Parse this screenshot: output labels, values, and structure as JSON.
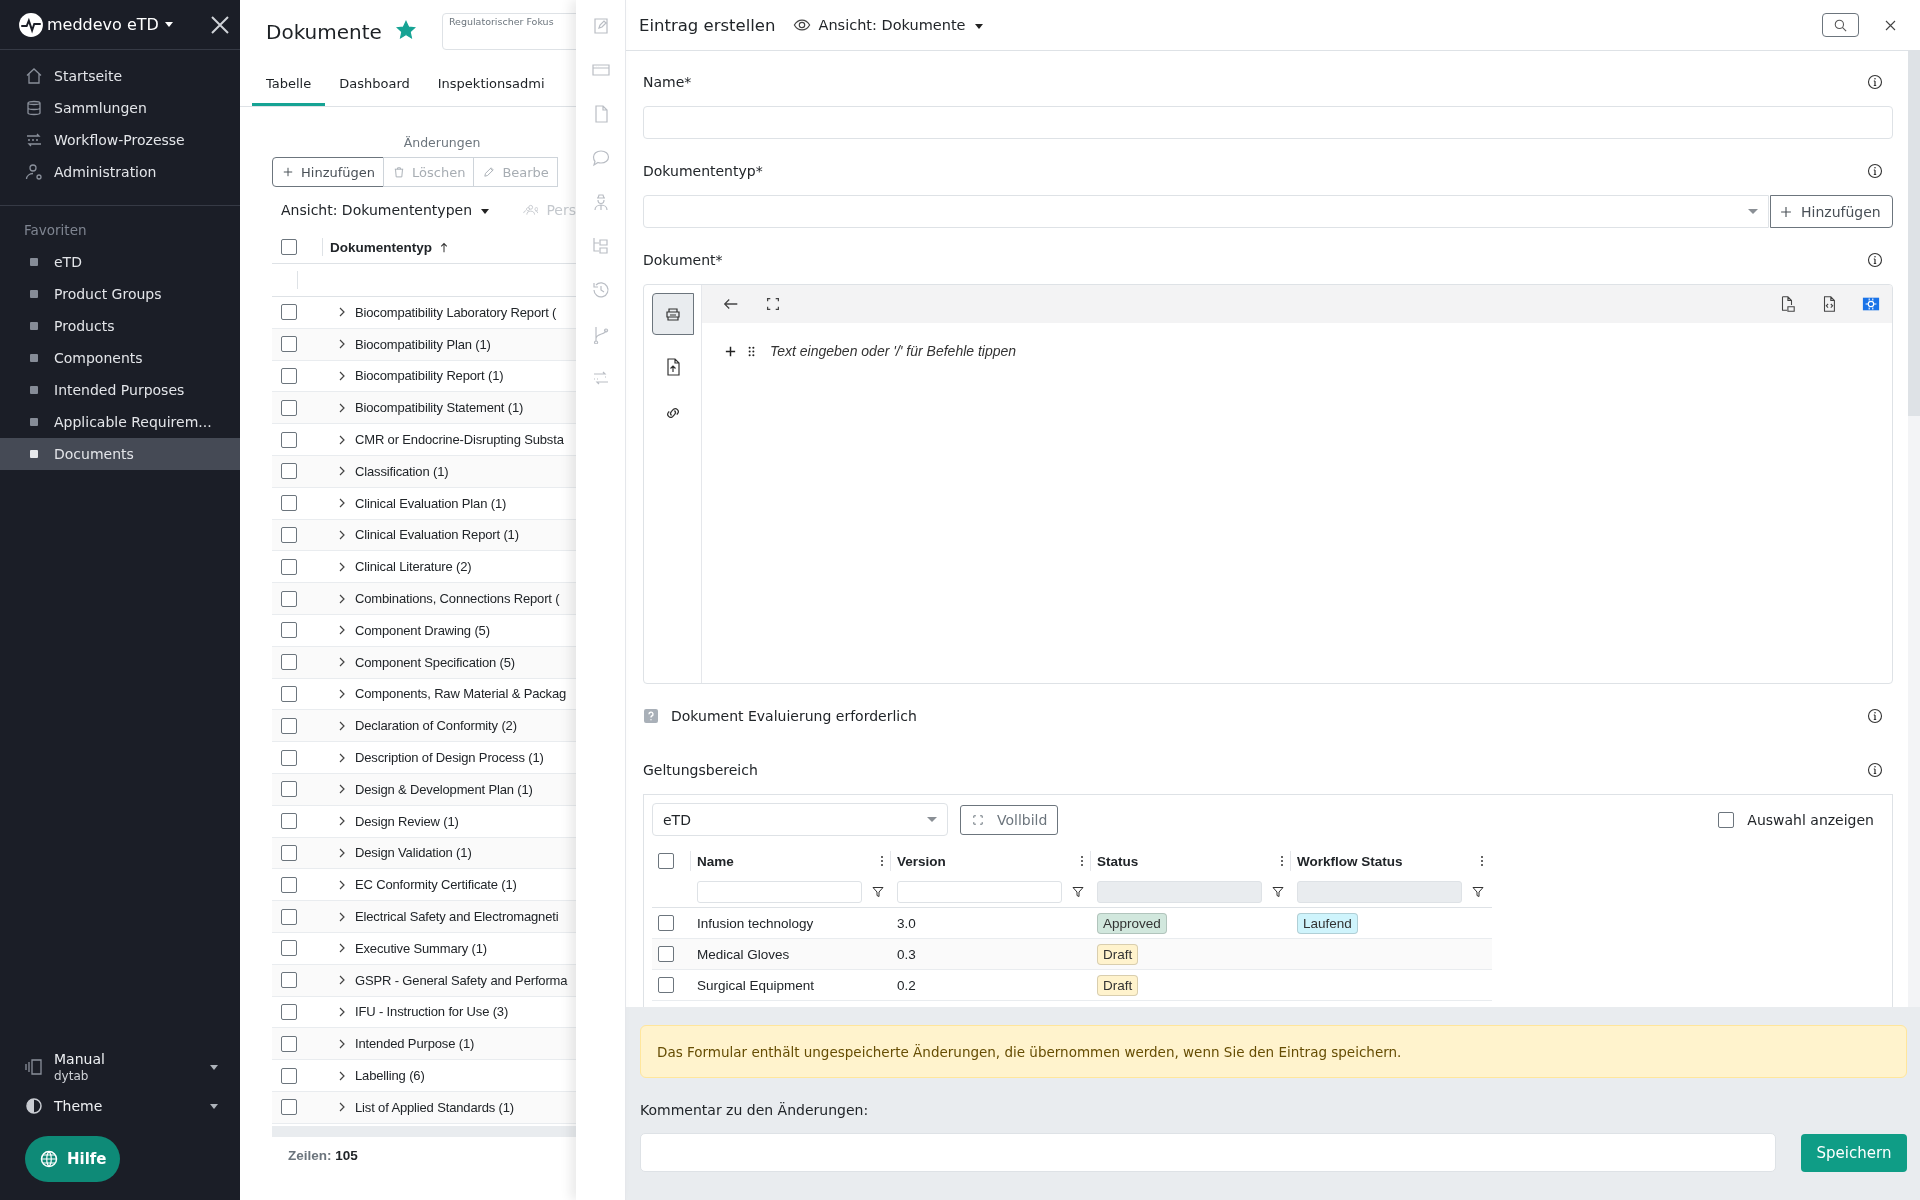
{
  "sidebar": {
    "brand": "meddevo eTD",
    "nav": [
      {
        "label": "Startseite"
      },
      {
        "label": "Sammlungen"
      },
      {
        "label": "Workflow-Prozesse"
      },
      {
        "label": "Administration"
      }
    ],
    "favorites_title": "Favoriten",
    "favorites": [
      {
        "label": "eTD",
        "selected": false
      },
      {
        "label": "Product Groups",
        "selected": false
      },
      {
        "label": "Products",
        "selected": false
      },
      {
        "label": "Components",
        "selected": false
      },
      {
        "label": "Intended Purposes",
        "selected": false
      },
      {
        "label": "Applicable Requirem...",
        "selected": false
      },
      {
        "label": "Documents",
        "selected": true
      }
    ],
    "workspace": {
      "name": "Manual",
      "tenant": "dytab"
    },
    "theme_label": "Theme",
    "help_label": "Hilfe"
  },
  "page": {
    "title": "Dokumente",
    "starred": true,
    "focus_label": "Regulatorischer Fokus",
    "tabs": [
      {
        "label": "Tabelle",
        "selected": true
      },
      {
        "label": "Dashboard",
        "selected": false
      },
      {
        "label": "Inspektionsadmi",
        "selected": false
      }
    ],
    "actions_title": "Änderungen",
    "actions": [
      {
        "label": "Hinzufügen",
        "disabled": false
      },
      {
        "label": "Löschen",
        "disabled": true
      },
      {
        "label": "Bearbe",
        "disabled": true
      }
    ],
    "view_label": "Ansicht: Dokumententypen",
    "persons_label": "Pers",
    "table": {
      "column": "Dokumententyp",
      "all_checked": false,
      "rows": [
        {
          "label": "Biocompatibility Laboratory Report (",
          "checked": false
        },
        {
          "label": "Biocompatibility Plan (1)",
          "checked": false
        },
        {
          "label": "Biocompatibility Report (1)",
          "checked": false
        },
        {
          "label": "Biocompatibility Statement (1)",
          "checked": false
        },
        {
          "label": "CMR or Endocrine-Disrupting Substa",
          "checked": false
        },
        {
          "label": "Classification (1)",
          "checked": false
        },
        {
          "label": "Clinical Evaluation Plan (1)",
          "checked": false
        },
        {
          "label": "Clinical Evaluation Report (1)",
          "checked": false
        },
        {
          "label": "Clinical Literature (2)",
          "checked": false
        },
        {
          "label": "Combinations, Connections Report (",
          "checked": false
        },
        {
          "label": "Component Drawing (5)",
          "checked": false
        },
        {
          "label": "Component Specification (5)",
          "checked": false
        },
        {
          "label": "Components, Raw Material & Packag",
          "checked": false
        },
        {
          "label": "Declaration of Conformity (2)",
          "checked": false
        },
        {
          "label": "Description of Design Process (1)",
          "checked": false
        },
        {
          "label": "Design & Development Plan (1)",
          "checked": false
        },
        {
          "label": "Design Review (1)",
          "checked": false
        },
        {
          "label": "Design Validation (1)",
          "checked": false
        },
        {
          "label": "EC Conformity Certificate (1)",
          "checked": false
        },
        {
          "label": "Electrical Safety and Electromagneti",
          "checked": false
        },
        {
          "label": "Executive Summary (1)",
          "checked": false
        },
        {
          "label": "GSPR - General Safety and Performa",
          "checked": false
        },
        {
          "label": "IFU - Instruction for Use (3)",
          "checked": false
        },
        {
          "label": "Intended Purpose (1)",
          "checked": false
        },
        {
          "label": "Labelling (6)",
          "checked": false
        },
        {
          "label": "List of Applied Standards (1)",
          "checked": false
        }
      ]
    },
    "rows_label": "Zeilen:",
    "rows_count": "105"
  },
  "drawer": {
    "title": "Eintrag erstellen",
    "view_label": "Ansicht: Dokumente",
    "fields": [
      {
        "kind": "text",
        "label": "Name*"
      },
      {
        "kind": "select",
        "label": "Dokumententyp*",
        "action": "Hinzufügen"
      },
      {
        "kind": "editor",
        "label": "Dokument*",
        "placeholder": "Text eingeben oder '/' für Befehle tippen"
      },
      {
        "kind": "flag",
        "label": "Dokument Evaluierung erforderlich",
        "indeterminate": true
      },
      {
        "kind": "scope",
        "label": "Geltungsbereich"
      }
    ],
    "scope": {
      "collection": "eTD",
      "fullscreen_label": "Vollbild",
      "show_selection": {
        "label": "Auswahl anzeigen",
        "checked": false
      },
      "columns": [
        "Name",
        "Version",
        "Status",
        "Workflow Status"
      ],
      "all_checked": false,
      "rows": [
        {
          "name": "Infusion technology",
          "version": "3.0",
          "status": {
            "label": "Approved",
            "color": "#d1e7dd"
          },
          "workflow": {
            "label": "Laufend",
            "color": "#cff4fc"
          },
          "checked": false
        },
        {
          "name": "Medical Gloves",
          "version": "0.3",
          "status": {
            "label": "Draft",
            "color": "#fff3cd"
          },
          "checked": false
        },
        {
          "name": "Surgical Equipment",
          "version": "0.2",
          "status": {
            "label": "Draft",
            "color": "#fff3cd"
          },
          "checked": false
        }
      ]
    },
    "notice": "Das Formular enthält ungespeicherte Änderungen, die übernommen werden, wenn Sie den Eintrag speichern.",
    "comment_label": "Kommentar zu den Änderungen:",
    "save_label": "Speichern"
  }
}
